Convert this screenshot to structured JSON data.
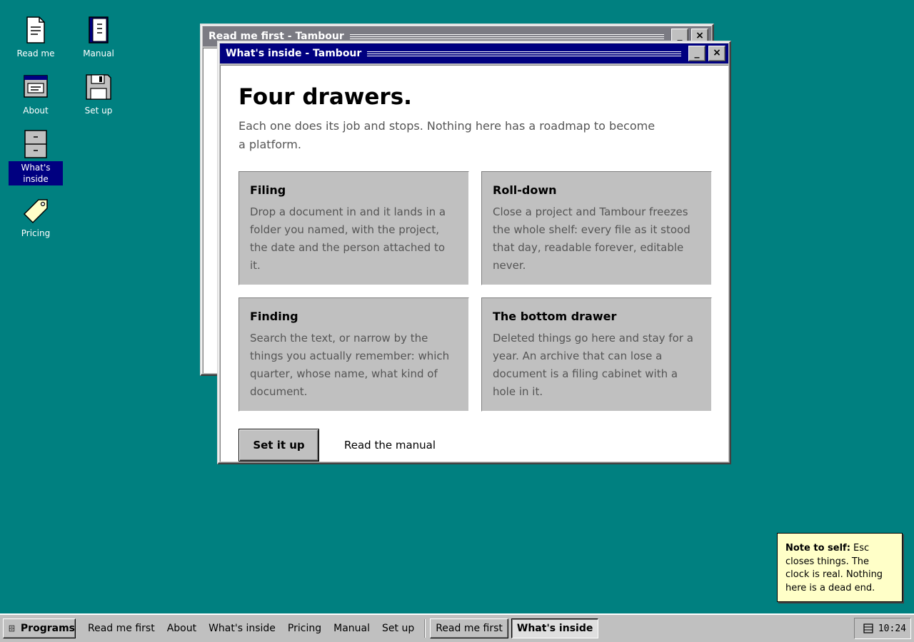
{
  "colors": {
    "desktop": "#008080",
    "active_titlebar": "#000080",
    "inactive_titlebar": "#7b7b83",
    "chrome": "#c0c0c0",
    "note_bg": "#ffffc8"
  },
  "desktop_icons": [
    {
      "label": "Read me",
      "icon": "document-icon"
    },
    {
      "label": "Manual",
      "icon": "book-icon"
    },
    {
      "label": "About",
      "icon": "window-icon"
    },
    {
      "label": "Set up",
      "icon": "floppy-disk-icon"
    },
    {
      "label": "What's inside",
      "icon": "filing-cabinet-icon",
      "selected": true
    },
    {
      "label": "Pricing",
      "icon": "price-tag-icon"
    }
  ],
  "back_window": {
    "title": "Read me first - Tambour",
    "minimize": "_",
    "close": "×"
  },
  "main_window": {
    "title": "What's inside - Tambour",
    "minimize": "_",
    "close": "×",
    "heading": "Four drawers.",
    "lede": "Each one does its job and stops. Nothing here has a roadmap to become a platform.",
    "cards": [
      {
        "title": "Filing",
        "body": "Drop a document in and it lands in a folder you named, with the project, the date and the person attached to it."
      },
      {
        "title": "Roll-down",
        "body": "Close a project and Tambour freezes the whole shelf: every file as it stood that day, readable forever, editable never."
      },
      {
        "title": "Finding",
        "body": "Search the text, or narrow by the things you actually remember: which quarter, whose name, what kind of document."
      },
      {
        "title": "The bottom drawer",
        "body": "Deleted things go here and stay for a year. An archive that can lose a document is a filing cabinet with a hole in it."
      }
    ],
    "primary_action": "Set it up",
    "secondary_action": "Read the manual"
  },
  "note": {
    "label": "Note to self:",
    "text": " Esc closes things. The clock is real. Nothing here is a dead end."
  },
  "taskbar": {
    "start_label": "Programs",
    "quick_links": [
      "Read me first",
      "About",
      "What's inside",
      "Pricing",
      "Manual",
      "Set up"
    ],
    "tasks": [
      {
        "label": "Read me first",
        "active": false
      },
      {
        "label": "What's inside",
        "active": true
      }
    ],
    "clock": "10:24"
  }
}
